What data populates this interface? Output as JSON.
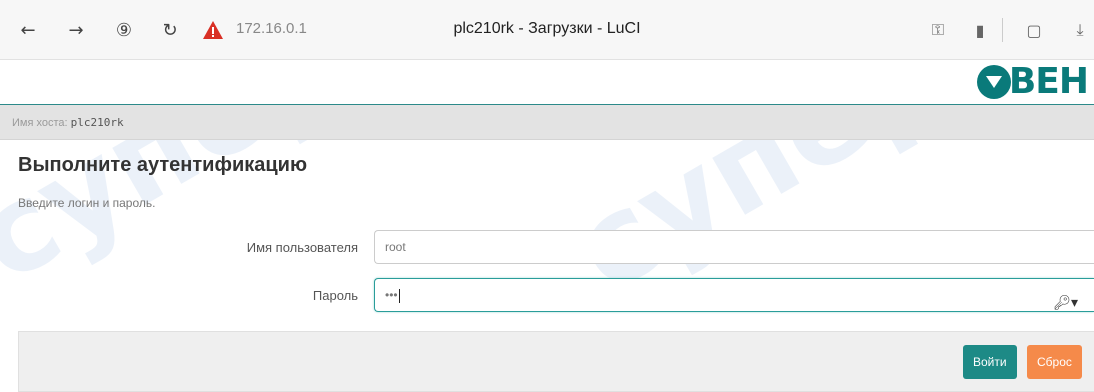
{
  "browser": {
    "address": "172.16.0.1",
    "tab_title": "plc210rk - Загрузки - LuCI",
    "icons": [
      "back-icon",
      "forward-icon",
      "yandex-icon",
      "reload-icon",
      "security-warning-icon",
      "translate-icon",
      "bookmark-icon",
      "reading-mode-icon",
      "download-icon"
    ]
  },
  "header": {
    "logo_text": "ВЕН"
  },
  "host": {
    "label": "Имя хоста:",
    "value": "plc210rk"
  },
  "auth": {
    "title": "Выполните аутентификацию",
    "description": "Введите логин и пароль.",
    "username_label": "Имя пользователя",
    "username_value": "root",
    "password_label": "Пароль",
    "password_value": "•••"
  },
  "actions": {
    "login": "Войти",
    "reset": "Сброс"
  },
  "watermark": "супер",
  "colors": {
    "accent": "#1d8a86",
    "reset": "#f58a4a",
    "warning": "#d93025"
  }
}
